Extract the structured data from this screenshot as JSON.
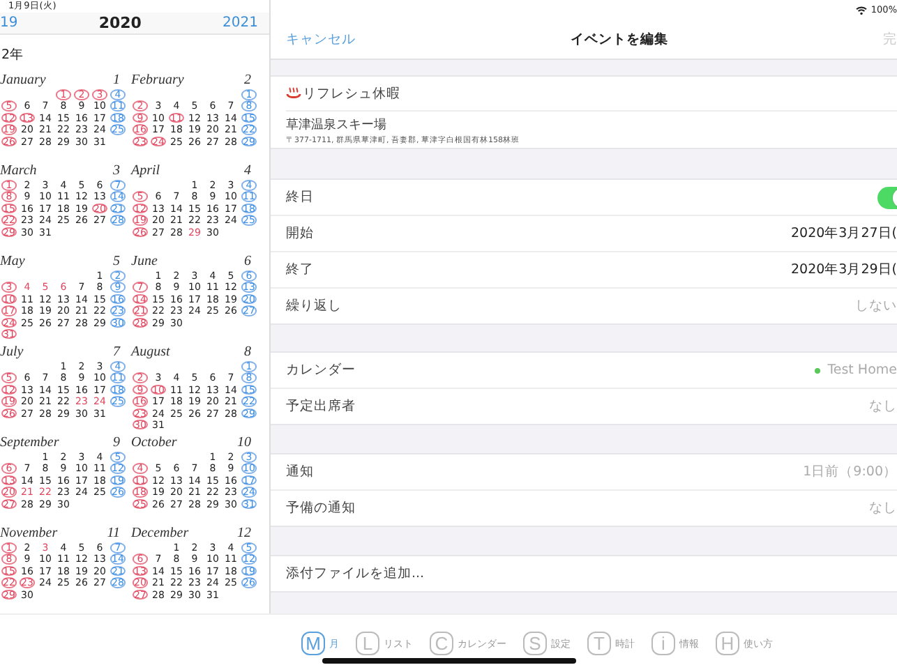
{
  "status_bar": {
    "date": "1月9日(火)",
    "battery": "100%"
  },
  "year_nav": {
    "previous": "19",
    "current": "2020",
    "next": "2021"
  },
  "era_label": "2年",
  "months": [
    {
      "name": "January",
      "number": "1",
      "weeks": [
        [
          {
            "day": "1",
            "holiday": true,
            "circled": true
          },
          {
            "day": "2",
            "holiday": true,
            "circled": true
          },
          {
            "day": "3",
            "holiday": true,
            "circled": true
          },
          "4"
        ],
        [
          "5",
          "6",
          "7",
          "8",
          "9",
          "10",
          "11"
        ],
        [
          "12",
          {
            "day": "13",
            "holiday": true,
            "circled": true
          },
          "14",
          "15",
          "16",
          "17",
          "18"
        ],
        [
          "19",
          "20",
          "21",
          "22",
          "23",
          "24",
          "25"
        ],
        [
          "26",
          "27",
          "28",
          "29",
          "30",
          "31"
        ]
      ]
    },
    {
      "name": "February",
      "number": "2",
      "weeks": [
        [
          "1"
        ],
        [
          "2",
          "3",
          "4",
          "5",
          "6",
          "7",
          "8"
        ],
        [
          "9",
          "10",
          {
            "day": "11",
            "holiday": true,
            "circled": true
          },
          "12",
          "13",
          "14",
          "15"
        ],
        [
          "16",
          "17",
          "18",
          "19",
          "20",
          "21",
          "22"
        ],
        [
          "23",
          {
            "day": "24",
            "holiday": true,
            "circled": true
          },
          "25",
          "26",
          "27",
          "28",
          "29"
        ]
      ]
    },
    {
      "name": "March",
      "number": "3",
      "weeks": [
        [
          "1",
          "2",
          "3",
          "4",
          "5",
          "6",
          "7"
        ],
        [
          "8",
          "9",
          "10",
          "11",
          "12",
          "13",
          "14"
        ],
        [
          "15",
          "16",
          "17",
          "18",
          "19",
          {
            "day": "20",
            "holiday": true,
            "circled": true
          },
          "21"
        ],
        [
          "22",
          "23",
          "24",
          "25",
          "26",
          "27",
          "28"
        ],
        [
          "29",
          "30",
          "31"
        ]
      ]
    },
    {
      "name": "April",
      "number": "4",
      "weeks": [
        [
          "1",
          "2",
          "3",
          "4"
        ],
        [
          "5",
          "6",
          "7",
          "8",
          "9",
          "10",
          "11"
        ],
        [
          "12",
          "13",
          "14",
          "15",
          "16",
          "17",
          "18"
        ],
        [
          "19",
          "20",
          "21",
          "22",
          "23",
          "24",
          "25"
        ],
        [
          "26",
          "27",
          "28",
          {
            "day": "29",
            "holiday": true,
            "circled": false
          },
          "30"
        ]
      ]
    },
    {
      "name": "May",
      "number": "5",
      "weeks": [
        [
          "1",
          "2"
        ],
        [
          "3",
          {
            "day": "4",
            "holiday": true,
            "circled": false
          },
          {
            "day": "5",
            "holiday": true,
            "circled": false
          },
          {
            "day": "6",
            "holiday": true,
            "circled": false
          },
          "7",
          "8",
          "9"
        ],
        [
          "10",
          "11",
          "12",
          "13",
          "14",
          "15",
          "16"
        ],
        [
          "17",
          "18",
          "19",
          "20",
          "21",
          "22",
          "23"
        ],
        [
          "24",
          "25",
          "26",
          "27",
          "28",
          "29",
          "30"
        ],
        [
          "31"
        ]
      ]
    },
    {
      "name": "June",
      "number": "6",
      "weeks": [
        [
          "1",
          "2",
          "3",
          "4",
          "5",
          "6"
        ],
        [
          "7",
          "8",
          "9",
          "10",
          "11",
          "12",
          "13"
        ],
        [
          "14",
          "15",
          "16",
          "17",
          "18",
          "19",
          "20"
        ],
        [
          "21",
          "22",
          "23",
          "24",
          "25",
          "26",
          "27"
        ],
        [
          "28",
          "29",
          "30"
        ]
      ]
    },
    {
      "name": "July",
      "number": "7",
      "weeks": [
        [
          "1",
          "2",
          "3",
          "4"
        ],
        [
          "5",
          "6",
          "7",
          "8",
          "9",
          "10",
          "11"
        ],
        [
          "12",
          "13",
          "14",
          "15",
          "16",
          "17",
          "18"
        ],
        [
          "19",
          "20",
          "21",
          "22",
          {
            "day": "23",
            "holiday": true,
            "circled": false
          },
          {
            "day": "24",
            "holiday": true,
            "circled": false
          },
          "25"
        ],
        [
          "26",
          "27",
          "28",
          "29",
          "30",
          "31"
        ]
      ]
    },
    {
      "name": "August",
      "number": "8",
      "weeks": [
        [
          "1"
        ],
        [
          "2",
          "3",
          "4",
          "5",
          "6",
          "7",
          "8"
        ],
        [
          "9",
          {
            "day": "10",
            "holiday": true,
            "circled": true
          },
          "11",
          "12",
          "13",
          "14",
          "15"
        ],
        [
          "16",
          "17",
          "18",
          "19",
          "20",
          "21",
          "22"
        ],
        [
          "23",
          "24",
          "25",
          "26",
          "27",
          "28",
          "29"
        ],
        [
          "30",
          "31"
        ]
      ]
    },
    {
      "name": "September",
      "number": "9",
      "weeks": [
        [
          "1",
          "2",
          "3",
          "4",
          "5"
        ],
        [
          "6",
          "7",
          "8",
          "9",
          "10",
          "11",
          "12"
        ],
        [
          "13",
          "14",
          "15",
          "16",
          "17",
          "18",
          "19"
        ],
        [
          "20",
          {
            "day": "21",
            "holiday": true,
            "circled": false
          },
          {
            "day": "22",
            "holiday": true,
            "circled": false
          },
          "23",
          "24",
          "25",
          "26"
        ],
        [
          "27",
          "28",
          "29",
          "30"
        ]
      ]
    },
    {
      "name": "October",
      "number": "10",
      "weeks": [
        [
          "1",
          "2",
          "3"
        ],
        [
          "4",
          "5",
          "6",
          "7",
          "8",
          "9",
          "10"
        ],
        [
          "11",
          "12",
          "13",
          "14",
          "15",
          "16",
          "17"
        ],
        [
          "18",
          "19",
          "20",
          "21",
          "22",
          "23",
          "24"
        ],
        [
          "25",
          "26",
          "27",
          "28",
          "29",
          "30",
          "31"
        ]
      ]
    },
    {
      "name": "November",
      "number": "11",
      "weeks": [
        [
          "1",
          "2",
          {
            "day": "3",
            "holiday": true,
            "circled": false
          },
          "4",
          "5",
          "6",
          "7"
        ],
        [
          "8",
          "9",
          "10",
          "11",
          "12",
          "13",
          "14"
        ],
        [
          "15",
          "16",
          "17",
          "18",
          "19",
          "20",
          "21"
        ],
        [
          "22",
          {
            "day": "23",
            "holiday": true,
            "circled": true
          },
          "24",
          "25",
          "26",
          "27",
          "28"
        ],
        [
          "29",
          "30"
        ]
      ]
    },
    {
      "name": "December",
      "number": "12",
      "weeks": [
        [
          "1",
          "2",
          "3",
          "4",
          "5"
        ],
        [
          "6",
          "7",
          "8",
          "9",
          "10",
          "11",
          "12"
        ],
        [
          "13",
          "14",
          "15",
          "16",
          "17",
          "18",
          "19"
        ],
        [
          "20",
          "21",
          "22",
          "23",
          "24",
          "25",
          "26"
        ],
        [
          "27",
          "28",
          "29",
          "30",
          "31"
        ]
      ]
    }
  ],
  "nav": {
    "cancel": "キャンセル",
    "title": "イベントを編集",
    "done": "完"
  },
  "event": {
    "title": "リフレシュ休暇",
    "location": "草津温泉スキー場",
    "address": "〒377-1711, 群馬県草津町, 吾妻郡, 草津字白根国有林158林班"
  },
  "sections": [
    [
      {
        "kind": "toggle",
        "label": "終日",
        "on": true
      },
      {
        "kind": "value",
        "label": "開始",
        "value": "2020年3月27日(",
        "muted": false
      },
      {
        "kind": "value",
        "label": "終了",
        "value": "2020年3月29日(",
        "muted": false
      },
      {
        "kind": "value",
        "label": "繰り返し",
        "value": "しない",
        "muted": true
      }
    ],
    [
      {
        "kind": "calendar",
        "label": "カレンダー",
        "value": "Test Home",
        "color": "#5ac85a"
      },
      {
        "kind": "value",
        "label": "予定出席者",
        "value": "なし",
        "muted": true
      }
    ],
    [
      {
        "kind": "value",
        "label": "通知",
        "value": "1日前（9:00）",
        "muted": true
      },
      {
        "kind": "value",
        "label": "予備の通知",
        "value": "なし",
        "muted": true
      }
    ],
    [
      {
        "kind": "action",
        "label": "添付ファイルを追加..."
      }
    ]
  ],
  "tabs": [
    {
      "letter": "M",
      "label": "月",
      "selected": true
    },
    {
      "letter": "L",
      "label": "リスト",
      "selected": false
    },
    {
      "letter": "C",
      "label": "カレンダー",
      "selected": false
    },
    {
      "letter": "S",
      "label": "設定",
      "selected": false
    },
    {
      "letter": "T",
      "label": "時計",
      "selected": false
    },
    {
      "letter": "i",
      "label": "情報",
      "selected": false
    },
    {
      "letter": "H",
      "label": "使い方",
      "selected": false
    }
  ]
}
